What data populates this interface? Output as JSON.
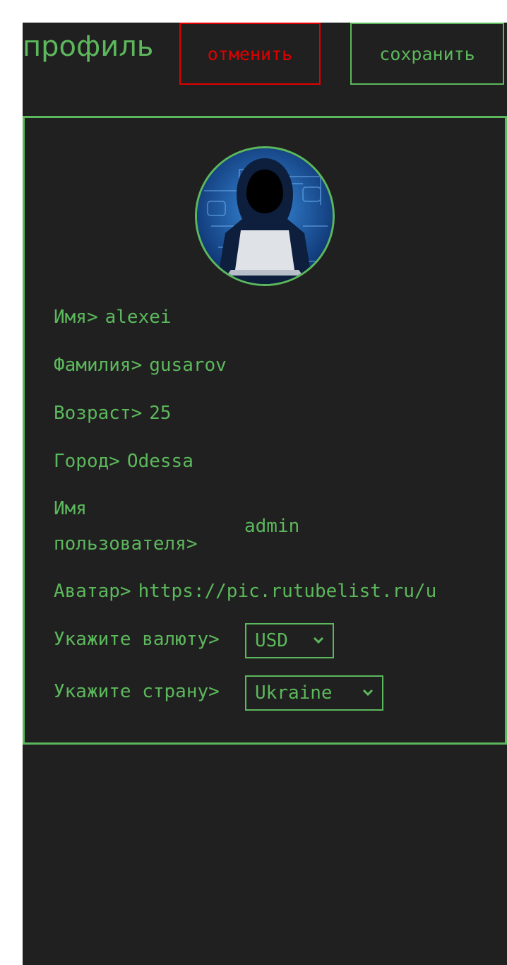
{
  "header": {
    "title": "профиль",
    "cancel_label": "отменить",
    "save_label": "сохранить"
  },
  "profile": {
    "first_name_label": "Имя>",
    "first_name": "alexei",
    "last_name_label": "Фамилия>",
    "last_name": "gusarov",
    "age_label": "Возраст>",
    "age": "25",
    "city_label": "Город>",
    "city": "Odessa",
    "username_label": "Имя пользователя>",
    "username": "admin",
    "avatar_label": "Аватар>",
    "avatar_url": "https://pic.rutubelist.ru/u",
    "currency_label": "Укажите валюту>",
    "currency": "USD",
    "country_label": "Укажите страну>",
    "country": "Ukraine"
  },
  "colors": {
    "accent": "#5cb85c",
    "danger": "#e00000",
    "background": "#202020"
  },
  "icons": {
    "avatar": "hooded-hacker-avatar",
    "dropdown": "chevron-down-icon"
  }
}
